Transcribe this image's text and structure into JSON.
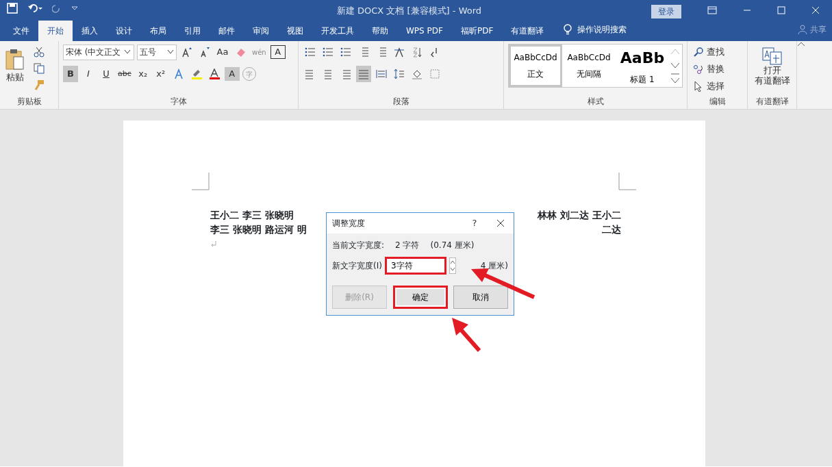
{
  "title_bar": {
    "title": "新建 DOCX 文档 [兼容模式]  -  Word",
    "login": "登录"
  },
  "tabs": [
    {
      "label": "文件",
      "selected": false
    },
    {
      "label": "开始",
      "selected": true
    },
    {
      "label": "插入",
      "selected": false
    },
    {
      "label": "设计",
      "selected": false
    },
    {
      "label": "布局",
      "selected": false
    },
    {
      "label": "引用",
      "selected": false
    },
    {
      "label": "邮件",
      "selected": false
    },
    {
      "label": "审阅",
      "selected": false
    },
    {
      "label": "视图",
      "selected": false
    },
    {
      "label": "开发工具",
      "selected": false
    },
    {
      "label": "帮助",
      "selected": false
    },
    {
      "label": "WPS PDF",
      "selected": false
    },
    {
      "label": "福昕PDF",
      "selected": false
    },
    {
      "label": "有道翻译",
      "selected": false
    }
  ],
  "tell_me": "操作说明搜索",
  "share": "共享",
  "ribbon": {
    "clipboard": {
      "paste": "粘贴",
      "group": "剪贴板"
    },
    "font": {
      "font_name": "宋体 (中文正文",
      "font_size": "五号",
      "change_case": "Aa",
      "format_buttons": [
        {
          "label": "B",
          "selected": true
        },
        {
          "label": "I",
          "selected": false
        },
        {
          "label": "U",
          "selected": false
        },
        {
          "label": "abc",
          "selected": false
        },
        {
          "label": "x₂",
          "selected": false
        },
        {
          "label": "x²",
          "selected": false
        }
      ],
      "phonetic": "wén",
      "char_border": "A",
      "char_shading": "A",
      "enclose": "字",
      "group": "字体"
    },
    "paragraph": {
      "group": "段落"
    },
    "styles": {
      "items": [
        {
          "preview": "AaBbCcDd",
          "name": "正文",
          "selected": true,
          "kind": "normal"
        },
        {
          "preview": "AaBbCcDd",
          "name": "无间隔",
          "selected": false,
          "kind": "normal"
        },
        {
          "preview": "AaBb",
          "name": "标题 1",
          "selected": false,
          "kind": "heading"
        }
      ],
      "group": "样式"
    },
    "editing": {
      "items": [
        "查找",
        "替换",
        "选择"
      ],
      "group": "编辑"
    },
    "youdao": {
      "button_lines": [
        "打开",
        "有道翻译"
      ],
      "group": "有道翻译"
    }
  },
  "document": {
    "lines": [
      {
        "left": "王小二 李三 张晓明",
        "right": "林林 刘二达 王小二"
      },
      {
        "left": "李三 张晓明  路运河  明",
        "right": "二达"
      }
    ]
  },
  "dialog": {
    "title": "调整宽度",
    "help": "?",
    "current_label": "当前文字宽度:",
    "current_value": "2 字符",
    "current_cm": "(0.74 厘米)",
    "new_label": "新文字宽度(I)",
    "new_value": "3字符",
    "new_cm": "4 厘米)",
    "buttons": [
      {
        "label": "删除(R)",
        "disabled": true,
        "highlighted": false
      },
      {
        "label": "确定",
        "disabled": false,
        "highlighted": true
      },
      {
        "label": "取消",
        "disabled": false,
        "highlighted": false
      }
    ],
    "field_highlighted": true
  }
}
